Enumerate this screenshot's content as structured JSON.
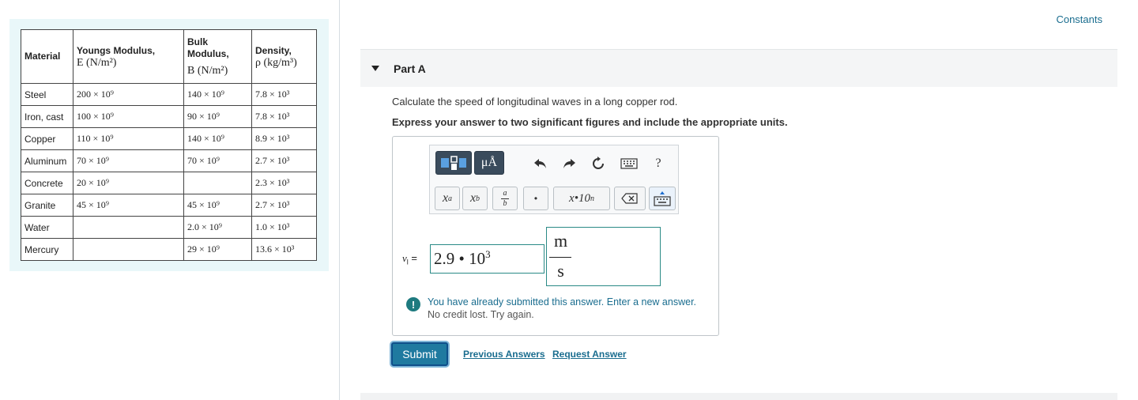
{
  "table": {
    "headers": {
      "material": "Material",
      "youngs_label": "Youngs Modulus,",
      "youngs_unit": "E (N/m²)",
      "bulk_label_1": "Bulk",
      "bulk_label_2": "Modulus,",
      "bulk_unit": "B (N/m²)",
      "density_label": "Density,",
      "density_unit": "ρ (kg/m³)"
    },
    "rows": [
      {
        "material": "Steel",
        "youngs": "200 × 10⁹",
        "bulk": "140 × 10⁹",
        "density": "7.8 × 10³"
      },
      {
        "material": "Iron, cast",
        "youngs": "100 × 10⁹",
        "bulk": "90 × 10⁹",
        "density": "7.8 × 10³"
      },
      {
        "material": "Copper",
        "youngs": "110 × 10⁹",
        "bulk": "140 × 10⁹",
        "density": "8.9 × 10³"
      },
      {
        "material": "Aluminum",
        "youngs": "70 × 10⁹",
        "bulk": "70 × 10⁹",
        "density": "2.7 × 10³"
      },
      {
        "material": "Concrete",
        "youngs": "20 × 10⁹",
        "bulk": "",
        "density": "2.3 × 10³"
      },
      {
        "material": "Granite",
        "youngs": "45 × 10⁹",
        "bulk": "45 × 10⁹",
        "density": "2.7 × 10³"
      },
      {
        "material": "Water",
        "youngs": "",
        "bulk": "2.0 × 10⁹",
        "density": "1.0 × 10³"
      },
      {
        "material": "Mercury",
        "youngs": "",
        "bulk": "29 × 10⁹",
        "density": "13.6 × 10³"
      }
    ]
  },
  "header": {
    "constants_link": "Constants"
  },
  "part": {
    "title": "Part A",
    "question": "Calculate the speed of longitudinal waves in a long copper rod.",
    "instruction": "Express your answer to two significant figures and include the appropriate units."
  },
  "toolbar": {
    "templates_icon": "templates-icon",
    "units_button": "μÅ",
    "undo_icon": "undo-icon",
    "redo_icon": "redo-icon",
    "reset_icon": "reset-icon",
    "keyboard_icon": "keyboard-icon",
    "help_label": "?",
    "superscript_label": "x",
    "superscript_sup": "a",
    "subscript_label": "x",
    "subscript_sub": "b",
    "fraction_num": "a",
    "fraction_den": "b",
    "dot_label": "•",
    "sci_label": "x•10",
    "sci_sup": "n",
    "delete_icon": "backspace-icon",
    "keyboard_toggle_icon": "keyboard-toggle-icon"
  },
  "answer": {
    "variable": "v",
    "variable_sub": "l",
    "equals": "=",
    "value_mantissa": "2.9 • 10",
    "value_exponent": "3",
    "unit_numerator": "m",
    "unit_denominator": "s"
  },
  "feedback": {
    "line1": "You have already submitted this answer. Enter a new answer.",
    "line2": "No credit lost. Try again."
  },
  "actions": {
    "submit": "Submit",
    "previous_answers": "Previous Answers",
    "request_answer": "Request Answer"
  },
  "colors": {
    "accent": "#1a6d8f",
    "submit_bg": "#1f7aa0",
    "panel_bg": "#e9f7f9"
  }
}
